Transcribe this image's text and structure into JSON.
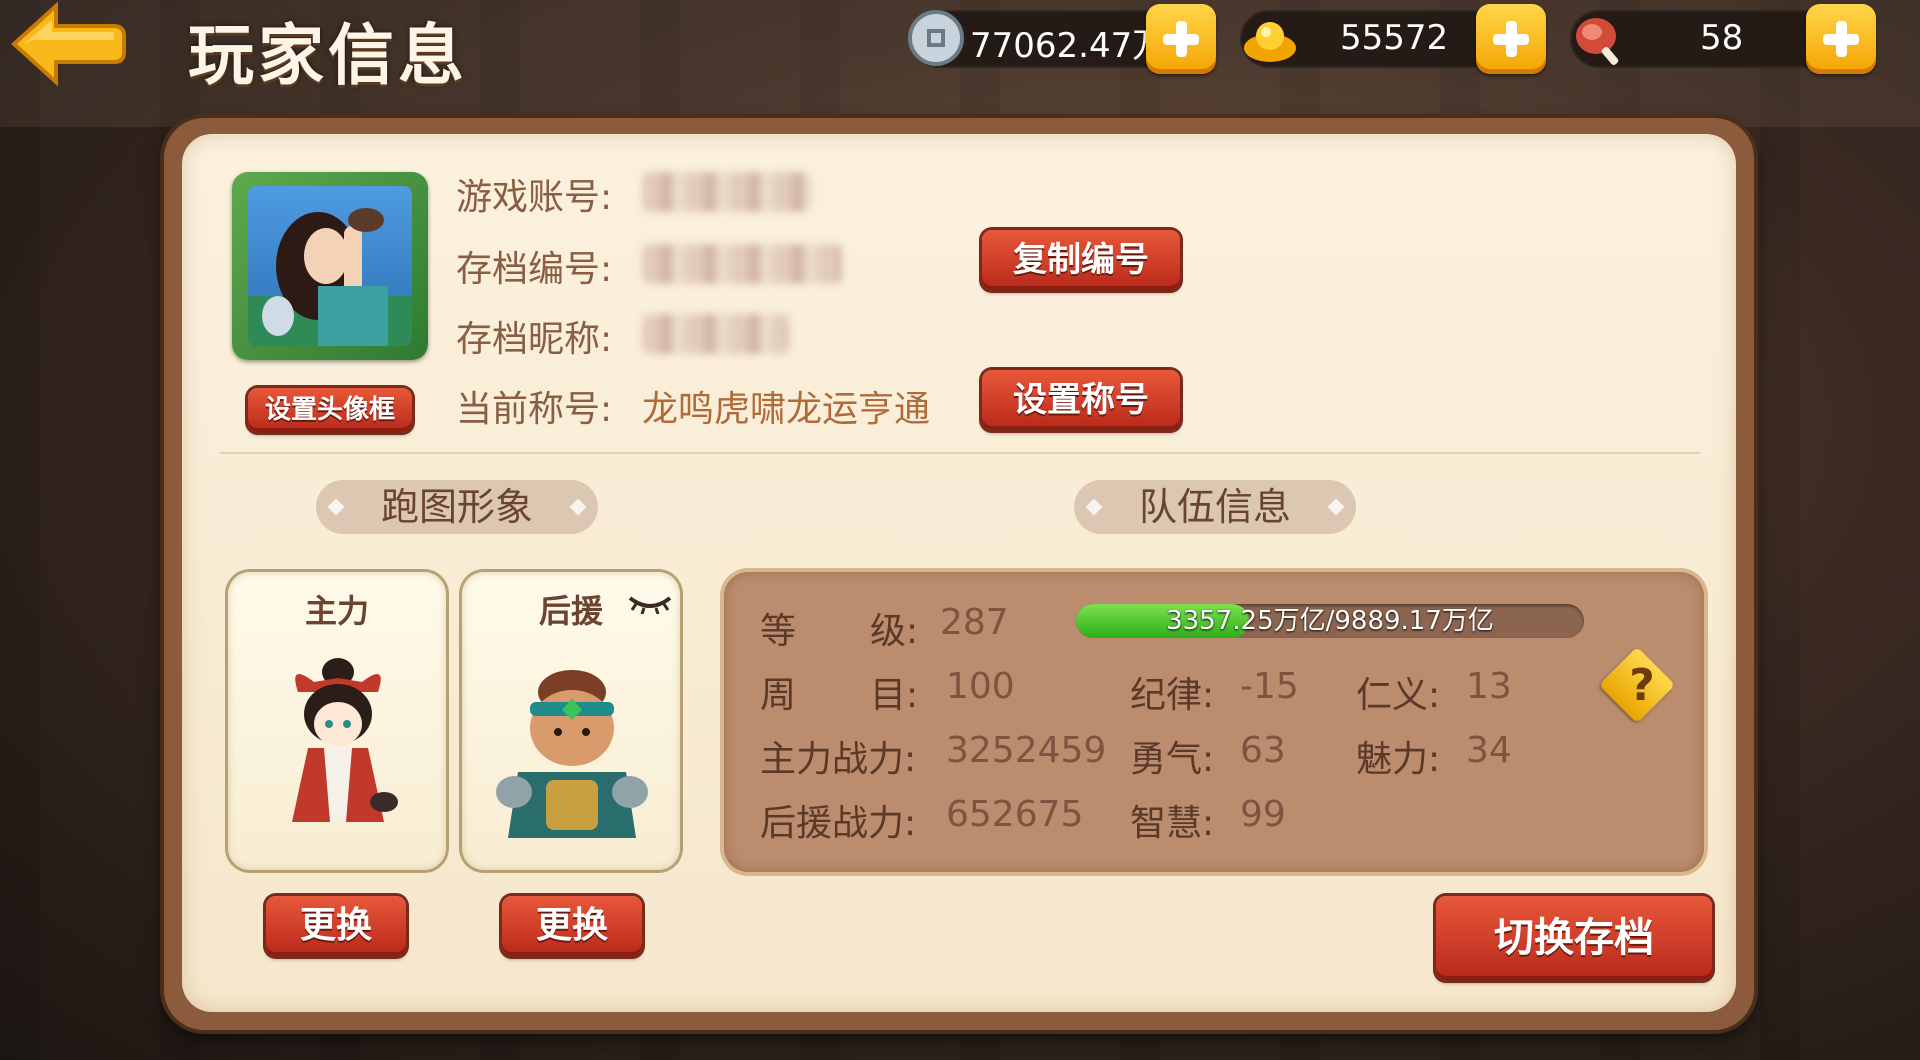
{
  "header": {
    "title": "玩家信息",
    "coins": "77062.47万",
    "gold": "55572",
    "stamina": "58"
  },
  "profile": {
    "account_label": "游戏账号:",
    "save_id_label": "存档编号:",
    "save_name_label": "存档昵称:",
    "title_label": "当前称号:",
    "title_value": "龙鸣虎啸龙运亨通",
    "copy_id_button": "复制编号",
    "set_title_button": "设置称号",
    "set_avatar_frame_button": "设置头像框"
  },
  "sections": {
    "map_image": "跑图形象",
    "team_info": "队伍信息"
  },
  "characters": {
    "main_label": "主力",
    "support_label": "后援",
    "change_button": "更换"
  },
  "team": {
    "level_label_1": "等",
    "level_label_2": "级:",
    "level": "287",
    "exp_text": "3357.25万亿/9889.17万亿",
    "exp_fraction": 0.34,
    "round_label_1": "周",
    "round_label_2": "目:",
    "round": "100",
    "discipline_label": "纪律:",
    "discipline": "-15",
    "benevolence_label": "仁义:",
    "benevolence": "13",
    "main_power_label": "主力战力:",
    "main_power": "3252459",
    "courage_label": "勇气:",
    "courage": "63",
    "charm_label": "魅力:",
    "charm": "34",
    "support_power_label": "后援战力:",
    "support_power": "652675",
    "wisdom_label": "智慧:",
    "wisdom": "99",
    "help": "?"
  },
  "switch_save_button": "切换存档"
}
